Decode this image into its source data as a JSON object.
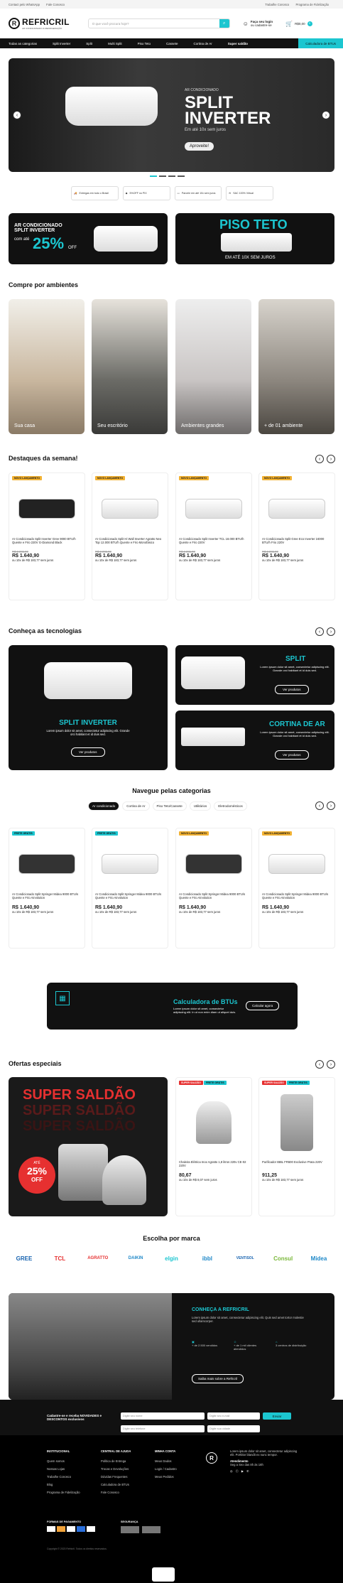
{
  "topbar": {
    "left": [
      "Contact pelo WhatsApp",
      "Fale Conosco"
    ],
    "right": [
      "Trabalhe Conosco",
      "Programa de Fidelização"
    ]
  },
  "header": {
    "logo": "REFRICRIL",
    "logo_sub": "AR CONDICIONADO & REFRIGERAÇÃO",
    "search_placeholder": "O que você procura hoje?",
    "user_line1": "Faça seu login",
    "user_line2": "ou cadastre-se",
    "cart_label": "R$0,00",
    "cart_count": "0"
  },
  "nav": {
    "items": [
      "Todas as categorias",
      "Split Inverter",
      "Split",
      "Multi Split",
      "Piso Teto",
      "Cassete",
      "Cortina de Ar",
      "Super saldão"
    ],
    "calc": "Calculadora de BTUs"
  },
  "hero": {
    "kicker": "AR CONDICIONADO",
    "title": "SPLIT INVERTER",
    "subtitle": "Em até 10x sem juros",
    "cta": "Aproveite!"
  },
  "benefits": [
    "Entregas em todo o Brasil",
    "5%OFF no PIX",
    "Parcele em até 10x sem juros",
    "SAC 100% Virtual"
  ],
  "banners": [
    {
      "title": "AR CONDICIONADO SPLIT INVERTER",
      "pre": "com até",
      "pct": "25%",
      "off": "OFF"
    },
    {
      "title": "PISO TETO",
      "sub": "EM ATÉ 10X SEM JUROS"
    }
  ],
  "ambientes": {
    "title": "Compre por ambientes",
    "items": [
      "Sua casa",
      "Seu escritório",
      "Ambientes grandes",
      "+ de 01 ambiente"
    ]
  },
  "destaques": {
    "title": "Destaques da semana!",
    "products": [
      {
        "tag": "NOVO LANÇAMENTO",
        "name": "Ar Condicionado Split Inverter Gree 9000 BTU/h Quente e Frio 220V G-Diamond Black",
        "old": "R$ 2.095,00",
        "price": "R$ 1.640,90",
        "inst": "ou 10x de R$ 183,77 sem juros"
      },
      {
        "tag": "NOVO LANÇAMENTO",
        "name": "Ar Condicionado Split Hi Wall Inverter Agratto Neo Top 12.000 BTU/h Quente e Frio Monofásico",
        "old": "R$ 2.095,00",
        "price": "R$ 1.640,90",
        "inst": "ou 10x de R$ 183,77 sem juros"
      },
      {
        "tag": "NOVO LANÇAMENTO",
        "name": "Ar Condicionado Split Inverter TCL 18.000 BTU/h Quente e Frio 220V",
        "old": "R$ 2.095,00",
        "price": "R$ 1.640,90",
        "inst": "ou 10x de R$ 183,77 sem juros"
      },
      {
        "tag": "NOVO LANÇAMENTO",
        "name": "Ar Condicionado Split Gree Eco Inverter 24000 BTU/h Frio 220V",
        "old": "R$ 2.095,00",
        "price": "R$ 1.640,90",
        "inst": "ou 10x de R$ 183,77 sem juros"
      }
    ]
  },
  "tecnologias": {
    "title": "Conheça as tecnologias",
    "items": [
      {
        "h": "SPLIT INVERTER",
        "p": "Lorem ipsum dolor sit amet, consectetur adipiscing elit. Grande orci habitant et id duis sed.",
        "btn": "Ver produtos"
      },
      {
        "h": "SPLIT",
        "p": "Lorem ipsum dolor sit amet, consectetur adipiscing elit. Grande orci habitant et id duis sed.",
        "btn": "Ver produtos"
      },
      {
        "h": "CORTINA DE AR",
        "p": "Lorem ipsum dolor sit amet, consectetur adipiscing elit. Grande orci habitant et id duis sed.",
        "btn": "Ver produtos"
      }
    ]
  },
  "categorias": {
    "title": "Navegue pelas categorias",
    "tabs": [
      "Ar condicionado",
      "Cortina de Ar",
      "Piso Teto/Cassete",
      "Utilitários",
      "Eletrodomésticos"
    ],
    "products": [
      {
        "tag": "FRETE GRÁTIS",
        "name": "Ar Condicionado Split Springer Midea 9000 BTU/s Quente e Frio Airvolution",
        "price": "R$ 1.640,90",
        "inst": "ou 10x de R$ 183,77 sem juros"
      },
      {
        "tag": "FRETE GRÁTIS",
        "name": "Ar Condicionado Split Springer Midea 9000 BTU/s Quente e Frio Airvolution",
        "price": "R$ 1.640,90",
        "inst": "ou 10x de R$ 183,77 sem juros"
      },
      {
        "tag": "NOVO LANÇAMENTO",
        "name": "Ar Condicionado Split Springer Midea 9000 BTU/s Quente e Frio Airvolution",
        "price": "R$ 1.640,90",
        "inst": "ou 10x de R$ 183,77 sem juros"
      },
      {
        "tag": "NOVO LANÇAMENTO",
        "name": "Ar Condicionado Split Springer Midea 9000 BTU/s Quente e Frio Airvolution",
        "price": "R$ 1.640,90",
        "inst": "ou 10x de R$ 183,77 sem juros"
      }
    ]
  },
  "calc_banner": {
    "title": "Calculadora de BTUs",
    "text": "Lorem ipsum dolor sit amet, consectetur adipiscing elit. In ut non enim diam ut aliquet duis.",
    "btn": "Calcular agora"
  },
  "ofertas": {
    "title": "Ofertas especiais",
    "banner": "SUPER SALDÃO",
    "pct": "25%",
    "off": "OFF",
    "pre": "ATÉ",
    "products": [
      {
        "tags": [
          "SUPER SALDÃO",
          "FRETE GRÁTIS"
        ],
        "name": "Chaleira Elétrica Inox Agratto 1,8 litros 220v CE-02 220V",
        "price": "80,67",
        "inst": "ou 10x de R$ 8,07 sem juros"
      },
      {
        "tags": [
          "SUPER SALDÃO",
          "FRETE GRÁTIS"
        ],
        "name": "Purificador IBBL FR600 Exclusive Prata 220V",
        "price": "911,25",
        "inst": "ou 10x de R$ 183,77 sem juros"
      }
    ]
  },
  "marcas": {
    "title": "Escolha por marca",
    "items": [
      "GREE",
      "TCL",
      "AGRATTO",
      "DAIKIN",
      "elgin",
      "ibbl",
      "VENTISOL",
      "Consul",
      "Midea"
    ]
  },
  "about": {
    "title": "CONHEÇA A REFRICRIL",
    "text": "Lorem ipsum dolor sit amet, consectetur adipiscing elit. Quis sed amet tortor molestie sed ullamcorper.",
    "stats": [
      "+ de 2.500 vendidos",
      "+ de 1 mil clientes atendidos",
      "3 centros de distribuição"
    ],
    "btn": "Saiba mais sobre a Refricril"
  },
  "newsletter": {
    "text": "Cadastre-se e receba NOVIDADES e DESCONTOS exclusivos",
    "name": "Digite seu nome",
    "email": "Digite seu e-mail",
    "phone": "Digite seu telefone",
    "city": "Digite sua cidade",
    "btn": "Enviar"
  },
  "footer": {
    "cols": [
      {
        "h": "INSTITUCIONAL",
        "items": [
          "Quem somos",
          "Nossas Lojas",
          "Trabalhe Conosco",
          "Blog",
          "Programa de Fidelização"
        ]
      },
      {
        "h": "CENTRAL DE AJUDA",
        "items": [
          "Política de Entrega",
          "Trocas e Devoluções",
          "Dúvidas Frequentes",
          "Calculadora de BTUs",
          "Fale Conosco"
        ]
      },
      {
        "h": "MINHA CONTA",
        "items": [
          "Meus Dados",
          "Login / Cadastro",
          "Meus Pedidos"
        ]
      }
    ],
    "desc": "Lorem ipsum dolor sit amet, consectetur adipiscing elit. Porttitor blandit ex nunc tempor.",
    "service": "Atendimento",
    "service_text": "Seg a Sex das 8h às 18h",
    "pay_label": "FORMAS DE PAGAMENTO",
    "sec_label": "SEGURANÇA",
    "copyright": "Copyright © 2023 Refricril. Todos os direitos reservados."
  }
}
